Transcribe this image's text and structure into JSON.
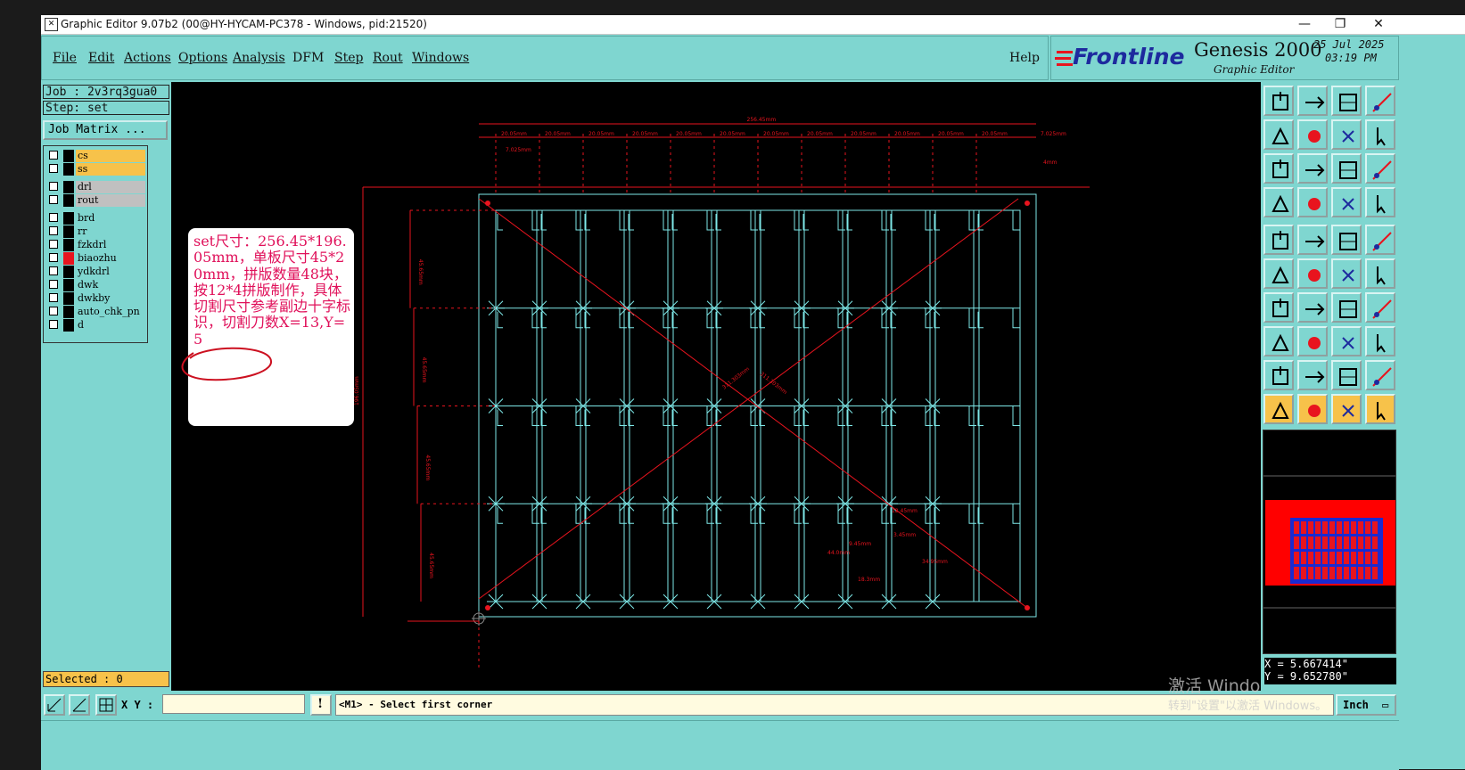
{
  "window": {
    "title": "Graphic Editor 9.07b2 (00@HY-HYCAM-PC378 - Windows, pid:21520)",
    "minimize": "—",
    "maximize": "❐",
    "close": "✕"
  },
  "menu": {
    "items": [
      "File",
      "Edit",
      "Actions",
      "Options",
      "Analysis",
      "DFM",
      "Step",
      "Rout",
      "Windows"
    ],
    "help": "Help"
  },
  "logo": {
    "brand": "Frontline",
    "product": "Genesis 2000",
    "subtitle": "Graphic Editor",
    "date": "25 Jul 2025",
    "time": "03:19 PM"
  },
  "job": {
    "job_label": "Job  : 2v3rq3gua0",
    "step_label": "Step: set",
    "matrix_button": "Job Matrix ..."
  },
  "layers": [
    {
      "name": "cs",
      "bg": "#f7c24a",
      "marker": "#000000"
    },
    {
      "name": "ss",
      "bg": "#f7c24a",
      "marker": "#000000"
    },
    {
      "name": "drl",
      "bg": "#c0c0c0",
      "marker": "#000000"
    },
    {
      "name": "rout",
      "bg": "#c0c0c0",
      "marker": "#000000"
    },
    {
      "name": "brd",
      "bg": "#7fd6d0",
      "marker": "#000000"
    },
    {
      "name": "rr",
      "bg": "#7fd6d0",
      "marker": "#000000"
    },
    {
      "name": "fzkdrl",
      "bg": "#7fd6d0",
      "marker": "#000000"
    },
    {
      "name": "biaozhu",
      "bg": "#7fd6d0",
      "marker": "#e8141e"
    },
    {
      "name": "ydkdrl",
      "bg": "#7fd6d0",
      "marker": "#000000"
    },
    {
      "name": "dwk",
      "bg": "#7fd6d0",
      "marker": "#000000"
    },
    {
      "name": "dwkby",
      "bg": "#7fd6d0",
      "marker": "#000000"
    },
    {
      "name": "auto_chk_pn",
      "bg": "#7fd6d0",
      "marker": "#000000"
    },
    {
      "name": "d",
      "bg": "#7fd6d0",
      "marker": "#000000"
    }
  ],
  "selected": "Selected : 0",
  "note": {
    "text": "set尺寸：256.45*196.05mm，单板尺寸45*20mm，拼版数量48块，按12*4拼版制作，具体切割尺寸参考副边十字标识，切割刀数X=13,Y=5"
  },
  "drawing": {
    "top_dims": [
      "20.05mm",
      "20.05mm",
      "20.05mm",
      "20.05mm",
      "20.05mm",
      "20.05mm",
      "20.05mm",
      "20.05mm",
      "20.05mm",
      "20.05mm",
      "20.05mm",
      "20.05mm"
    ],
    "overall_width": "256.45mm",
    "overall_height": "196.05mm",
    "row_dims": [
      "45.65mm",
      "45.65mm",
      "45.65mm",
      "45.65mm"
    ],
    "edge_dims": [
      "7.025mm",
      "4mm",
      "4mm",
      "7.025mm"
    ],
    "diag_dims": [
      "311.303mm",
      "311.303mm"
    ],
    "detail_dims": [
      "12.45mm",
      "3.45mm",
      "9.45mm",
      "44.0mm",
      "18.3mm",
      "34.95mm"
    ],
    "colors": {
      "board": "#7ee8e8",
      "dim": "#e8141e",
      "background": "#000000"
    }
  },
  "coords": {
    "x": "X = 5.667414\"",
    "y": "Y = 9.652780\""
  },
  "statusbar": {
    "xy_label": "X Y :",
    "prompt": "<M1> - Select first corner",
    "units": "Inch"
  },
  "watermark": {
    "line1": "激活 Windo",
    "line2": "转到\"设置\"以激活 Windows。"
  },
  "tools": [
    "move-icon",
    "copy-icon",
    "home-icon",
    "grid-icon",
    "left-icon",
    "right-icon",
    "undo-icon",
    "redo-icon",
    "fit-icon",
    "zoom-icon",
    "scale-icon",
    "help-icon",
    "measure-icon",
    "grid-snap-icon",
    "route-icon",
    "route2-icon",
    "pad-icon",
    "frame-icon",
    "ruler-icon",
    "dot-icon",
    "node-icon",
    "delete-node-icon",
    "add-point-icon",
    "connect-icon",
    "line-icon",
    "line2-icon",
    "arc-icon",
    "split-icon",
    "trace-icon",
    "cut-icon",
    "center-icon",
    "shapes-icon",
    "triangle-icon",
    "text-a-icon",
    "text-a2-icon",
    "text-a3-icon",
    "pointer-icon",
    "pointer2-icon",
    "pointer3-icon",
    "route-edit-icon"
  ]
}
